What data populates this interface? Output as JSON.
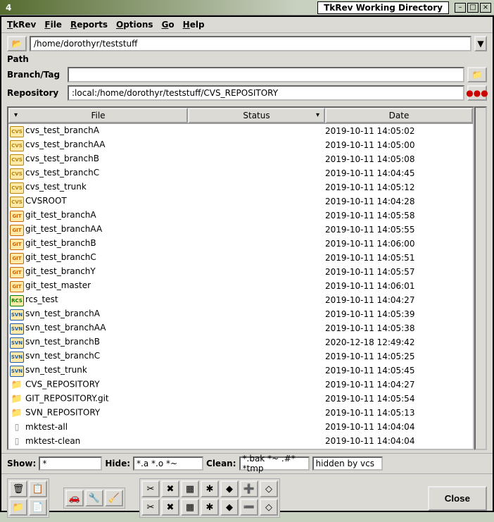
{
  "titlebar": {
    "title": "TkRev Working Directory",
    "minimize": "–",
    "maximize": "□",
    "close": "×"
  },
  "app_icon": "4",
  "menu": {
    "tkrev": "TkRev",
    "file": "File",
    "reports": "Reports",
    "options": "Options",
    "go": "Go",
    "help": "Help"
  },
  "labels": {
    "path": "Path",
    "branch_tag": "Branch/Tag",
    "repository": "Repository"
  },
  "fields": {
    "path_value": "/home/dorothyr/teststuff",
    "branch_tag_value": "",
    "repository_value": ":local:/home/dorothyr/teststuff/CVS_REPOSITORY"
  },
  "columns": {
    "file": "File",
    "status": "Status",
    "date": "Date"
  },
  "rows": [
    {
      "icon": "cvs",
      "tag": "CVS",
      "file": "cvs_test_branchA",
      "status": "<directory:CVS>",
      "date": "2019-10-11 14:05:02"
    },
    {
      "icon": "cvs",
      "tag": "CVS",
      "file": "cvs_test_branchAA",
      "status": "<directory:CVS>",
      "date": "2019-10-11 14:05:00"
    },
    {
      "icon": "cvs",
      "tag": "CVS",
      "file": "cvs_test_branchB",
      "status": "<directory:CVS>",
      "date": "2019-10-11 14:05:08"
    },
    {
      "icon": "cvs",
      "tag": "CVS",
      "file": "cvs_test_branchC",
      "status": "<directory:CVS>",
      "date": "2019-10-11 14:04:45"
    },
    {
      "icon": "cvs",
      "tag": "CVS",
      "file": "cvs_test_trunk",
      "status": "<directory:CVS>",
      "date": "2019-10-11 14:05:12"
    },
    {
      "icon": "cvs",
      "tag": "CVS",
      "file": "CVSROOT",
      "status": "<directory:CVS>",
      "date": "2019-10-11 14:04:28"
    },
    {
      "icon": "git",
      "tag": "GIT",
      "file": "git_test_branchA",
      "status": "<directory:GIT>",
      "date": "2019-10-11 14:05:58"
    },
    {
      "icon": "git",
      "tag": "GIT",
      "file": "git_test_branchAA",
      "status": "<directory:GIT>",
      "date": "2019-10-11 14:05:55"
    },
    {
      "icon": "git",
      "tag": "GIT",
      "file": "git_test_branchB",
      "status": "<directory:GIT>",
      "date": "2019-10-11 14:06:00"
    },
    {
      "icon": "git",
      "tag": "GIT",
      "file": "git_test_branchC",
      "status": "<directory:GIT>",
      "date": "2019-10-11 14:05:51"
    },
    {
      "icon": "git",
      "tag": "GIT",
      "file": "git_test_branchY",
      "status": "<directory:GIT>",
      "date": "2019-10-11 14:05:57"
    },
    {
      "icon": "git",
      "tag": "GIT",
      "file": "git_test_master",
      "status": "<directory:GIT>",
      "date": "2019-10-11 14:06:01"
    },
    {
      "icon": "rcs",
      "tag": "RCS",
      "file": "rcs_test",
      "status": "<directory:RCS>",
      "date": "2019-10-11 14:04:27"
    },
    {
      "icon": "svn",
      "tag": "SVN",
      "file": "svn_test_branchA",
      "status": "<directory:SVN>",
      "date": "2019-10-11 14:05:39"
    },
    {
      "icon": "svn",
      "tag": "SVN",
      "file": "svn_test_branchAA",
      "status": "<directory:SVN>",
      "date": "2019-10-11 14:05:38"
    },
    {
      "icon": "svn",
      "tag": "SVN",
      "file": "svn_test_branchB",
      "status": "<directory:SVN>",
      "date": "2020-12-18 12:49:42"
    },
    {
      "icon": "svn",
      "tag": "SVN",
      "file": "svn_test_branchC",
      "status": "<directory:SVN>",
      "date": "2019-10-11 14:05:25"
    },
    {
      "icon": "svn",
      "tag": "SVN",
      "file": "svn_test_trunk",
      "status": "<directory:SVN>",
      "date": "2019-10-11 14:05:45"
    },
    {
      "icon": "dir",
      "tag": "📁",
      "file": "CVS_REPOSITORY",
      "status": "<directory>",
      "date": "2019-10-11 14:04:27"
    },
    {
      "icon": "dir",
      "tag": "📁",
      "file": "GIT_REPOSITORY.git",
      "status": "<directory>",
      "date": "2019-10-11 14:05:54"
    },
    {
      "icon": "dir",
      "tag": "📁",
      "file": "SVN_REPOSITORY",
      "status": "<directory>",
      "date": "2019-10-11 14:05:13"
    },
    {
      "icon": "file",
      "tag": "▯",
      "file": "mktest-all",
      "status": "<file>",
      "date": "2019-10-11 14:04:04"
    },
    {
      "icon": "file",
      "tag": "▯",
      "file": "mktest-clean",
      "status": "<file>",
      "date": "2019-10-11 14:04:04"
    }
  ],
  "filter": {
    "show_label": "Show:",
    "show_value": "*",
    "hide_label": "Hide:",
    "hide_value": "*.a *.o *~",
    "clean_label": "Clean:",
    "clean_value": "*.bak *~ .#* *tmp",
    "hidden_label": "hidden by vcs"
  },
  "toolbar_icons": {
    "g1r1": [
      "🗑",
      "📋"
    ],
    "g1r2": [
      "📁",
      "📄"
    ],
    "g2": [
      "🚗",
      "🔧",
      "🧹"
    ],
    "g3r1": [
      "✂",
      "✖",
      "▦",
      "✱",
      "◆",
      "➕",
      "◇"
    ],
    "g3r2": [
      "✂",
      "✖",
      "▦",
      "✱",
      "◆",
      "➖",
      "◇"
    ]
  },
  "close_label": "Close"
}
